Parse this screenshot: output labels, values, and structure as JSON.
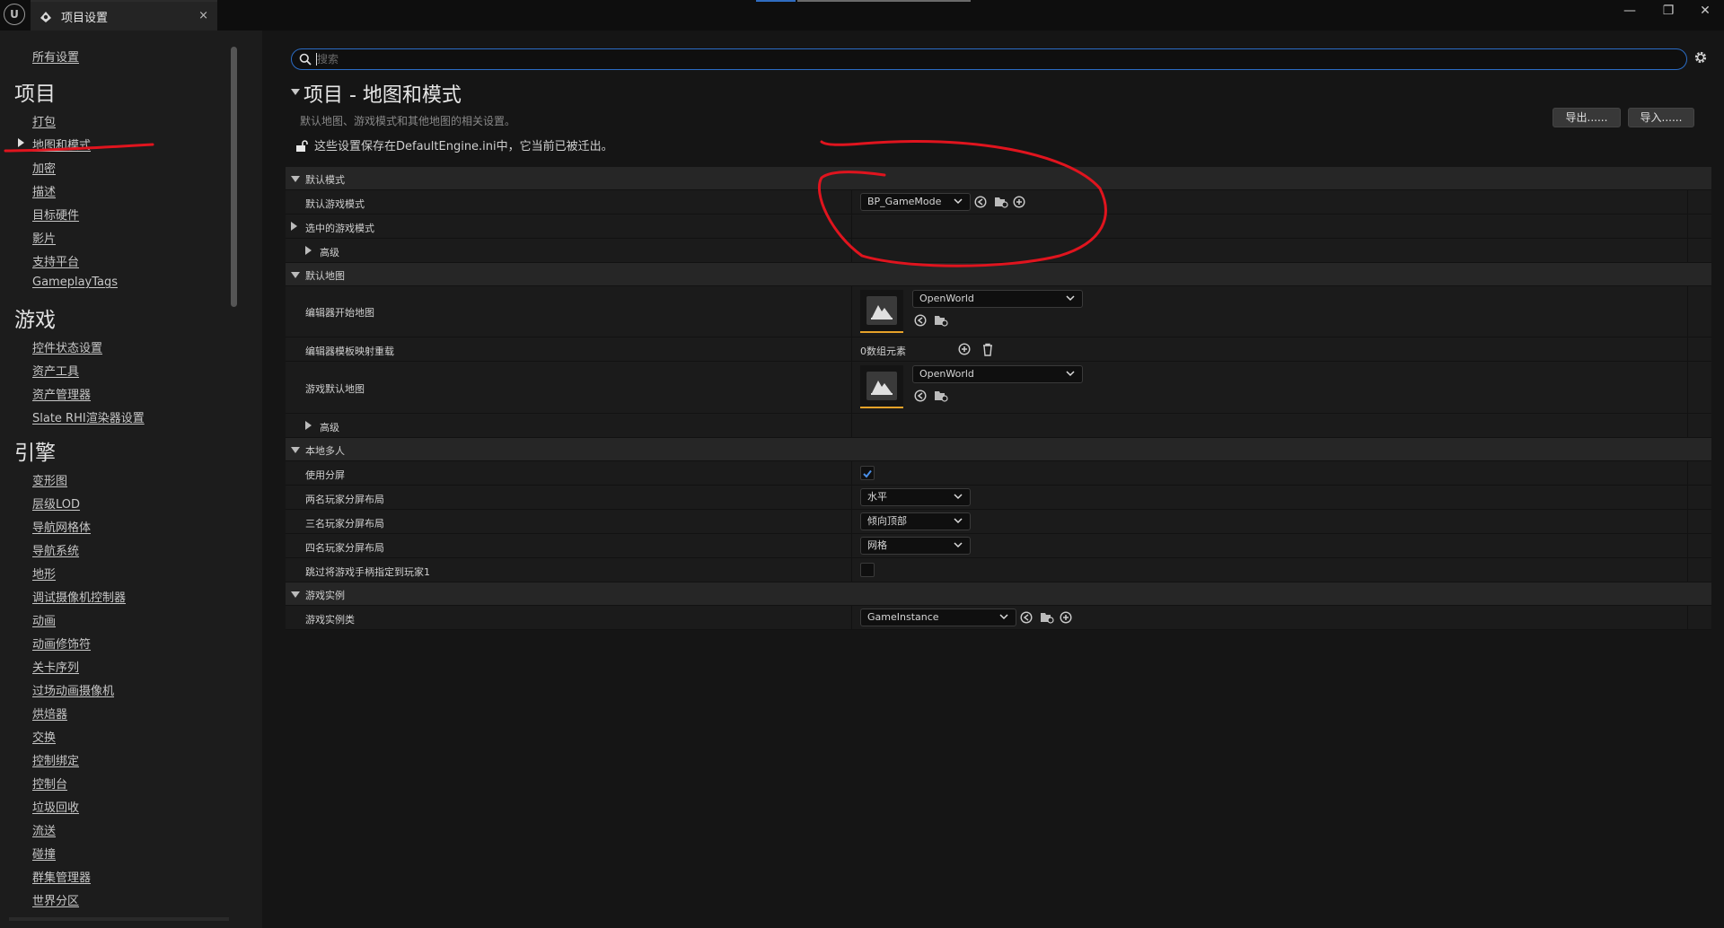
{
  "window": {
    "tab_title": "项目设置",
    "tab_close": "×",
    "minimize": "—",
    "restore": "❐",
    "close": "✕"
  },
  "sidebar": {
    "all_settings": "所有设置",
    "sections": [
      {
        "title": "项目",
        "items": [
          "打包",
          "地图和模式",
          "加密",
          "描述",
          "目标硬件",
          "影片",
          "支持平台",
          "GameplayTags"
        ]
      },
      {
        "title": "游戏",
        "items": [
          "控件状态设置",
          "资产工具",
          "资产管理器",
          "Slate RHI渲染器设置"
        ]
      },
      {
        "title": "引擎",
        "items": [
          "变形图",
          "层级LOD",
          "导航网格体",
          "导航系统",
          "地形",
          "调试摄像机控制器",
          "动画",
          "动画修饰符",
          "关卡序列",
          "过场动画摄像机",
          "烘焙器",
          "交换",
          "控制绑定",
          "控制台",
          "垃圾回收",
          "流送",
          "碰撞",
          "群集管理器",
          "世界分区"
        ]
      }
    ],
    "selected_item": "地图和模式"
  },
  "search": {
    "placeholder": "搜索",
    "value": ""
  },
  "header": {
    "title": "项目 - 地图和模式",
    "description": "默认地图、游戏模式和其他地图的相关设置。",
    "config_note": "这些设置保存在DefaultEngine.ini中，它当前已被迁出。",
    "export_label": "导出......",
    "import_label": "导入......"
  },
  "properties": {
    "default_modes": {
      "category": "默认模式",
      "default_game_mode_label": "默认游戏模式",
      "default_game_mode_value": "BP_GameMode",
      "selected_game_mode_label": "选中的游戏模式",
      "advanced_label": "高级"
    },
    "default_maps": {
      "category": "默认地图",
      "editor_startup_map_label": "编辑器开始地图",
      "editor_startup_map_value": "OpenWorld",
      "editor_template_map_overrides_label": "编辑器模板映射重载",
      "editor_template_map_overrides_value": "0数组元素",
      "game_default_map_label": "游戏默认地图",
      "game_default_map_value": "OpenWorld",
      "advanced_label": "高级"
    },
    "local_multiplayer": {
      "category": "本地多人",
      "use_splitscreen_label": "使用分屏",
      "use_splitscreen_checked": true,
      "two_player_layout_label": "两名玩家分屏布局",
      "two_player_layout_value": "水平",
      "three_player_layout_label": "三名玩家分屏布局",
      "three_player_layout_value": "倾向顶部",
      "four_player_layout_label": "四名玩家分屏布局",
      "four_player_layout_value": "网格",
      "skip_gamepad_label": "跳过将游戏手柄指定到玩家1",
      "skip_gamepad_checked": false
    },
    "game_instance": {
      "category": "游戏实例",
      "game_instance_class_label": "游戏实例类",
      "game_instance_class_value": "GameInstance"
    }
  },
  "colors": {
    "accent_blue": "#2b6cc4",
    "thumbnail_underline": "#e6a229",
    "annotation_red": "#e0141e"
  }
}
